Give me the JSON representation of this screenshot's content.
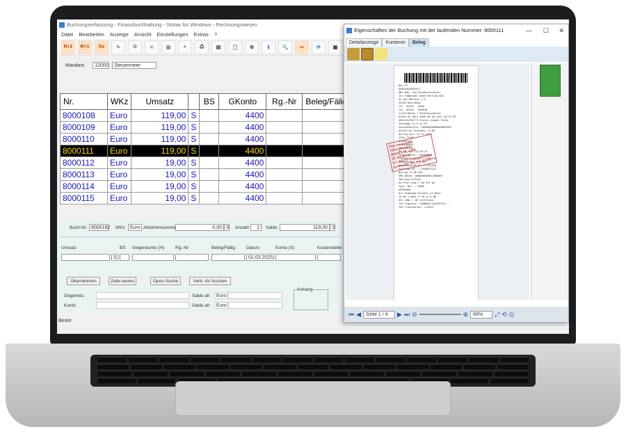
{
  "app": {
    "title": "Buchungserfassung - Finanzbuchhaltung - Stotax für Windows - Rechnungswesen",
    "menu": [
      "Datei",
      "Bearbeiten",
      "Anzeige",
      "Ansicht",
      "Einstellungen",
      "Extras",
      "?"
    ],
    "toolbar": [
      "R+1",
      "R+1",
      "fix"
    ],
    "mandant_label": "Mandant",
    "mandant_nr": "12000",
    "mandant_name": "Steuermeier",
    "status": "Bereit"
  },
  "table": {
    "headers": [
      "Nr.",
      "WKz",
      "Umsatz",
      "",
      "BS",
      "GKonto",
      "Rg.-Nr",
      "Beleg/Fälig"
    ],
    "rows": [
      [
        "8000108",
        "Euro",
        "119,00",
        "S",
        "4400"
      ],
      [
        "8000109",
        "Euro",
        "119,00",
        "S",
        "4400"
      ],
      [
        "8000110",
        "Euro",
        "119,00",
        "S",
        "4400"
      ],
      [
        "8000111",
        "Euro",
        "119,00",
        "S",
        "4400"
      ],
      [
        "8000112",
        "Euro",
        "19,00",
        "S",
        "4400"
      ],
      [
        "8000113",
        "Euro",
        "19,00",
        "S",
        "4400"
      ],
      [
        "8000114",
        "Euro",
        "19,00",
        "S",
        "4400"
      ],
      [
        "8000115",
        "Euro",
        "19,00",
        "S",
        "4400"
      ]
    ],
    "selected_index": 3
  },
  "form": {
    "buchnr_label": "Buch-Nr.",
    "buchnr": "8000182",
    "wkz_label": "WKz",
    "wkz": "Euro",
    "abstimm_label": "Abstimmsumme",
    "abstimm": "0,00",
    "abstimm_s": "S",
    "anzahl_label": "Anzahl",
    "anzahl": "1",
    "saldo_label": "Saldo",
    "saldo": "119,00",
    "saldo_s": "S",
    "col_umsatz": "Umsatz",
    "col_bs": "BS",
    "col_gegenkonto": "Gegenkonto (H)",
    "col_rgnr": "Rg.-Nr",
    "col_beleg": "Beleg/Fällig",
    "col_datum": "Datum",
    "col_konto": "Konto (S)",
    "col_kostenstelle": "Kostenstelle",
    "bs_value": "S",
    "datum_value": "01.03.2025",
    "btn_uebernehmen": "Übernehmen",
    "btn_zeile": "Zeile leeren",
    "btn_opos": "Opos-Suche",
    "btn_verb": "Verb. AV löschen",
    "gegenkto_label": "Gegenkto.",
    "konto_label": "Konto",
    "saldo_alt_label": "Saldo alt",
    "saldo_alt_wkz": "Euro",
    "anhang_label": "Anhang"
  },
  "dialog": {
    "title": "Eigenschaften der Buchung mit der laufenden Nummer: 8000111",
    "tabs": [
      "Detailanzeige",
      "Kontierer",
      "Beleg"
    ],
    "active_tab": 2,
    "page_label": "Seite 1 / 4",
    "zoom": "69%",
    "receipt_lines": [
      "Bon-ID",
      "06041001082941",
      "OBI Bau- und Heimwerkermarkt",
      "Chr.Faßbender GmbH Betrieb 082",
      "An den Märkten 1-5",
      "53359 Rheinbach",
      "Tel. 02226 - 8960",
      "Fax. 02226 - 896640",
      "Lieferdatum = Rechnungsdatum",
      "09455 03 0811 0900  08.08.2022 10:22:39",
      "4031244754773  Alpine Ausgen Farbe",
      "Endsumme in €   42,99",
      "Geschenkkarte: 20980000000000003205",
      "Aktuelles Guthaben: 0.00",
      "gültig bis: 31.12.2026",
      "VISA            13,00",
      "Bezahlung",
      "Visa Debit",
      "kontaktlos",
      "08.08.2022          10:28:25",
      "Terminal-ID       = 65088603",
      "Transaktions-Nr.  = 791092",
      "Belegnummer       = 4329",
      "Genehmigungs-Nr.  = 022030",
      "Vertrags-Nr.      = 4558813112",
      "Betrag                13,00 EUR",
      "EMV-Daten: 00000000000/000000",
      "Zahlung erfolgt",
      "AS-Proc-Code = 00 075 00",
      "Capt.-Ref. = 0000",
      "APPROVED",
      "Die Endsumme enthält an MwSt",
      "19,00 % MwSt  9     36,13    6,86",
      "USt-IdNr.: DE 123375104",
      "TSE-Signatur: YgRNmWj1skU1EPJT4...",
      "TSE-Transaktion:         111944"
    ],
    "stamp_lines": [
      "Buchungsnr. Mitarbeiter",
      "8000111  100 SUPERVIS",
      "03.2025  Gegenkonto",
      "gebucht  42,99  4400"
    ]
  }
}
